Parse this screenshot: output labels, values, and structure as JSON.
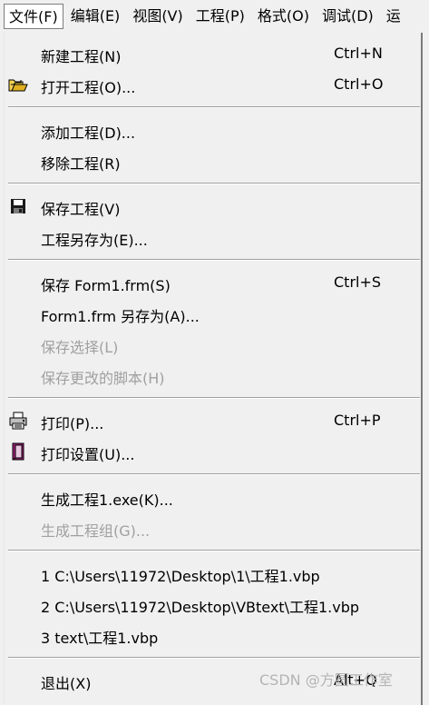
{
  "menubar": {
    "items": [
      "文件(F)",
      "编辑(E)",
      "视图(V)",
      "工程(P)",
      "格式(O)",
      "调试(D)",
      "运"
    ]
  },
  "file_menu": {
    "new_project": {
      "label": "新建工程(N)",
      "shortcut": "Ctrl+N"
    },
    "open_project": {
      "label": "打开工程(O)...",
      "shortcut": "Ctrl+O"
    },
    "add_project": {
      "label": "添加工程(D)..."
    },
    "remove_project": {
      "label": "移除工程(R)"
    },
    "save_project": {
      "label": "保存工程(V)"
    },
    "save_project_as": {
      "label": "工程另存为(E)..."
    },
    "save_form": {
      "label": "保存 Form1.frm(S)",
      "shortcut": "Ctrl+S"
    },
    "save_form_as": {
      "label": "Form1.frm 另存为(A)..."
    },
    "save_selection": {
      "label": "保存选择(L)"
    },
    "save_changed_scripts": {
      "label": "保存更改的脚本(H)"
    },
    "print": {
      "label": "打印(P)...",
      "shortcut": "Ctrl+P"
    },
    "print_setup": {
      "label": "打印设置(U)..."
    },
    "make_exe": {
      "label": "生成工程1.exe(K)..."
    },
    "make_group": {
      "label": "生成工程组(G)..."
    },
    "recent": [
      {
        "label": "1 C:\\Users\\11972\\Desktop\\1\\工程1.vbp"
      },
      {
        "label": "2 C:\\Users\\11972\\Desktop\\VBtext\\工程1.vbp"
      },
      {
        "label": "3 text\\工程1.vbp"
      }
    ],
    "exit": {
      "label": "退出(X)",
      "shortcut": "Alt+Q"
    }
  },
  "icons": {
    "open_project": "open-folder-icon",
    "save_project": "floppy-disk-icon",
    "print": "printer-icon",
    "print_setup": "print-setup-icon"
  },
  "watermark": "CSDN @方圆工作室"
}
